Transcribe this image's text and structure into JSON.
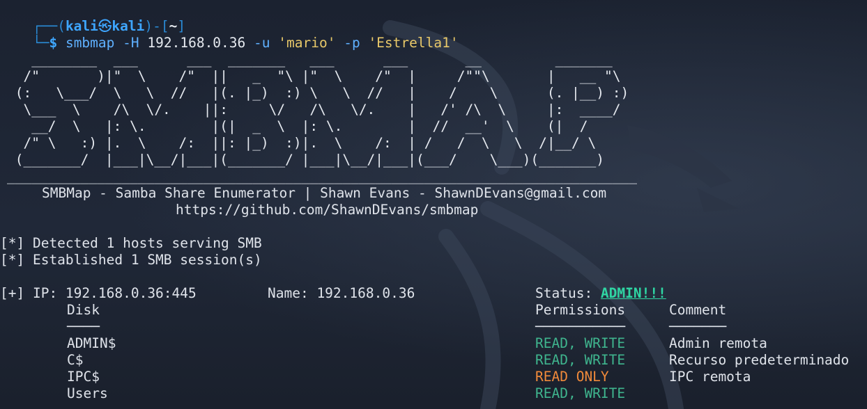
{
  "prompt": {
    "top_left": "┌──(",
    "user": "kali",
    "skull": "㉿",
    "host": "kali",
    "mid": ")-[",
    "dir": "~",
    "end": "]",
    "bottom_left": "└─",
    "dollar": "$"
  },
  "command": {
    "program": "smbmap",
    "flag_host": "-H",
    "host": "192.168.0.36",
    "flag_user": "-u",
    "user": "'mario'",
    "flag_pass": "-p",
    "pass": "'Estrella1'"
  },
  "banner_art": [
    "   ________  ___      ___  _______   ___      ___       __         _______",
    "  /\"       )|\"  \\    /\"  ||   _  \"\\ |\"  \\    /\"  |     /\"\"\\       |   __ \"\\",
    " (:   \\___/  \\   \\  //   |(. |_)  :) \\   \\  //   |    /    \\      (. |__) :)",
    "  \\___  \\    /\\  \\/.    ||:     \\/   /\\   \\/.    |   /' /\\  \\     |:  ____/",
    "   __/  \\   |: \\.        |(|  _  \\  |: \\.        |  //  __'  \\    (|  /",
    "  /\" \\   :) |.  \\    /:  ||: |_)  :)|.  \\    /:  | /   /  \\   \\  /|__/ \\",
    " (_______/  |___|\\__/|___|(_______/ |___|\\__/|___|(___/    \\___)(_______)",
    "_____________________________________________________________________________"
  ],
  "banner_sub1": "SMBMap - Samba Share Enumerator | Shawn Evans - ShawnDEvans@gmail.com",
  "banner_sub2": "https://github.com/ShawnDEvans/smbmap",
  "info": {
    "detected": "[*] Detected 1 hosts serving SMB",
    "established": "[*] Established 1 SMB session(s)"
  },
  "host_line": {
    "ip": "[+] IP: 192.168.0.36:445",
    "name": "Name: 192.168.0.36",
    "status_label": "Status: ",
    "status_value": "ADMIN!!!"
  },
  "table": {
    "headers": {
      "disk": "Disk",
      "permissions": "Permissions",
      "comment": "Comment"
    },
    "underlines": {
      "disk": "────",
      "permissions": "───────────",
      "comment": "───────"
    },
    "rows": [
      {
        "disk": "ADMIN$",
        "permissions": "READ, WRITE",
        "perm_type": "rw",
        "comment": "Admin remota"
      },
      {
        "disk": "C$",
        "permissions": "READ, WRITE",
        "perm_type": "rw",
        "comment": "Recurso predeterminado"
      },
      {
        "disk": "IPC$",
        "permissions": "READ ONLY",
        "perm_type": "ro",
        "comment": "IPC remota"
      },
      {
        "disk": "Users",
        "permissions": "READ, WRITE",
        "perm_type": "rw",
        "comment": ""
      }
    ]
  },
  "colors": {
    "background": "#1c2330",
    "prompt_blue": "#3ea6ff",
    "string_yellow": "#e8c869",
    "read_write_green": "#3fb58e",
    "read_only_orange": "#f08a3a",
    "admin_teal": "#2fd5a3"
  }
}
